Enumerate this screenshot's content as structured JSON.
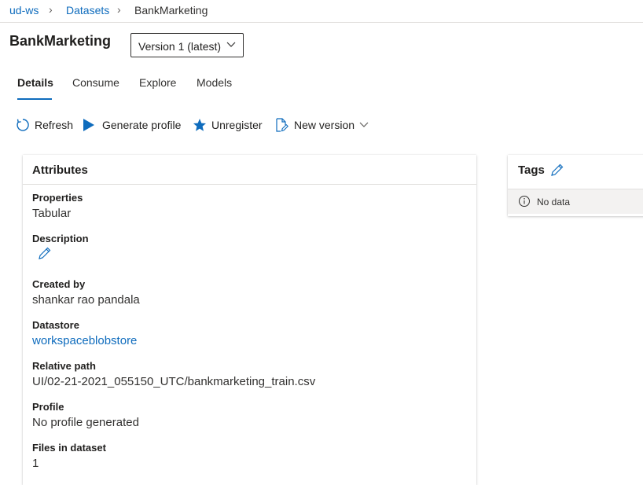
{
  "breadcrumb": {
    "workspace": "ud-ws",
    "datasets": "Datasets",
    "current": "BankMarketing"
  },
  "header": {
    "title": "BankMarketing",
    "version_selected": "Version 1 (latest)"
  },
  "tabs": [
    {
      "label": "Details",
      "active": true
    },
    {
      "label": "Consume"
    },
    {
      "label": "Explore"
    },
    {
      "label": "Models"
    }
  ],
  "commands": {
    "refresh": "Refresh",
    "generate_profile": "Generate profile",
    "unregister": "Unregister",
    "new_version": "New version"
  },
  "attributes": {
    "title": "Attributes",
    "properties_label": "Properties",
    "properties_value": "Tabular",
    "description_label": "Description",
    "created_by_label": "Created by",
    "created_by_value": "shankar rao pandala",
    "datastore_label": "Datastore",
    "datastore_value": "workspaceblobstore",
    "relative_path_label": "Relative path",
    "relative_path_value": "UI/02-21-2021_055150_UTC/bankmarketing_train.csv",
    "profile_label": "Profile",
    "profile_value": "No profile generated",
    "files_label": "Files in dataset",
    "files_value": "1"
  },
  "tags": {
    "title": "Tags",
    "empty_text": "No data"
  },
  "colors": {
    "accent": "#0f6cbd",
    "text": "#323130",
    "border": "#e1dfdd"
  }
}
